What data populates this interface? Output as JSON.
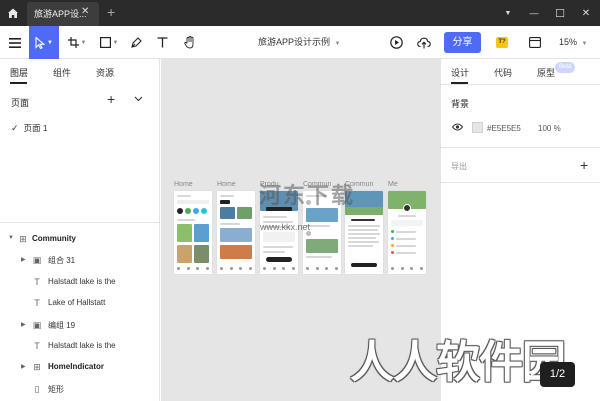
{
  "titlebar": {
    "tab_title": "旅游APP设...",
    "tab_close": "✕",
    "tab_add": "+",
    "window": {
      "dropdown": "▼",
      "minimize": "—",
      "maximize": "☐",
      "close": "✕"
    }
  },
  "toolbar": {
    "menu_icon": "menu-icon",
    "doc_title": "旅游APP设计示例",
    "share_label": "分享",
    "badge_label": "T?",
    "zoom": "15%",
    "accent": "#4f6bf5"
  },
  "left_panel": {
    "tabs": [
      "图层",
      "组件",
      "资源"
    ],
    "pages_heading": "页面",
    "pages_add": "+",
    "pages": [
      {
        "label": "页面 1",
        "selected": true
      }
    ],
    "layers": [
      {
        "label": "Community",
        "bold": true,
        "icon": "frame-icon",
        "expanded": true
      },
      {
        "label": "组合 31",
        "icon": "group-icon"
      },
      {
        "label": "Halstadt lake is the",
        "icon": "text-icon"
      },
      {
        "label": "Lake of Hallstatt",
        "icon": "text-icon"
      },
      {
        "label": "编组 19",
        "icon": "group-icon"
      },
      {
        "label": "Halstadt lake is the",
        "icon": "text-icon"
      },
      {
        "label": "HomeIndicator",
        "bold": true,
        "icon": "frame-icon"
      },
      {
        "label": "矩形",
        "icon": "rectangle-icon"
      }
    ]
  },
  "canvas": {
    "background": "#E5E5E5",
    "frames": [
      "Home",
      "Home",
      "Produ",
      "Commun",
      "Commun",
      "Me"
    ],
    "watermark": "河东下载",
    "watermark_url": "www.kkx.net"
  },
  "right_panel": {
    "tabs": [
      "设计",
      "代码",
      "原型"
    ],
    "beta": "Beta",
    "background_heading": "背景",
    "hex": "#E5E5E5",
    "opacity": "100 %",
    "export_label": "导出",
    "export_add": "+"
  },
  "overlay": {
    "big_watermark": "人人软件园",
    "fab_label": "1/2"
  }
}
